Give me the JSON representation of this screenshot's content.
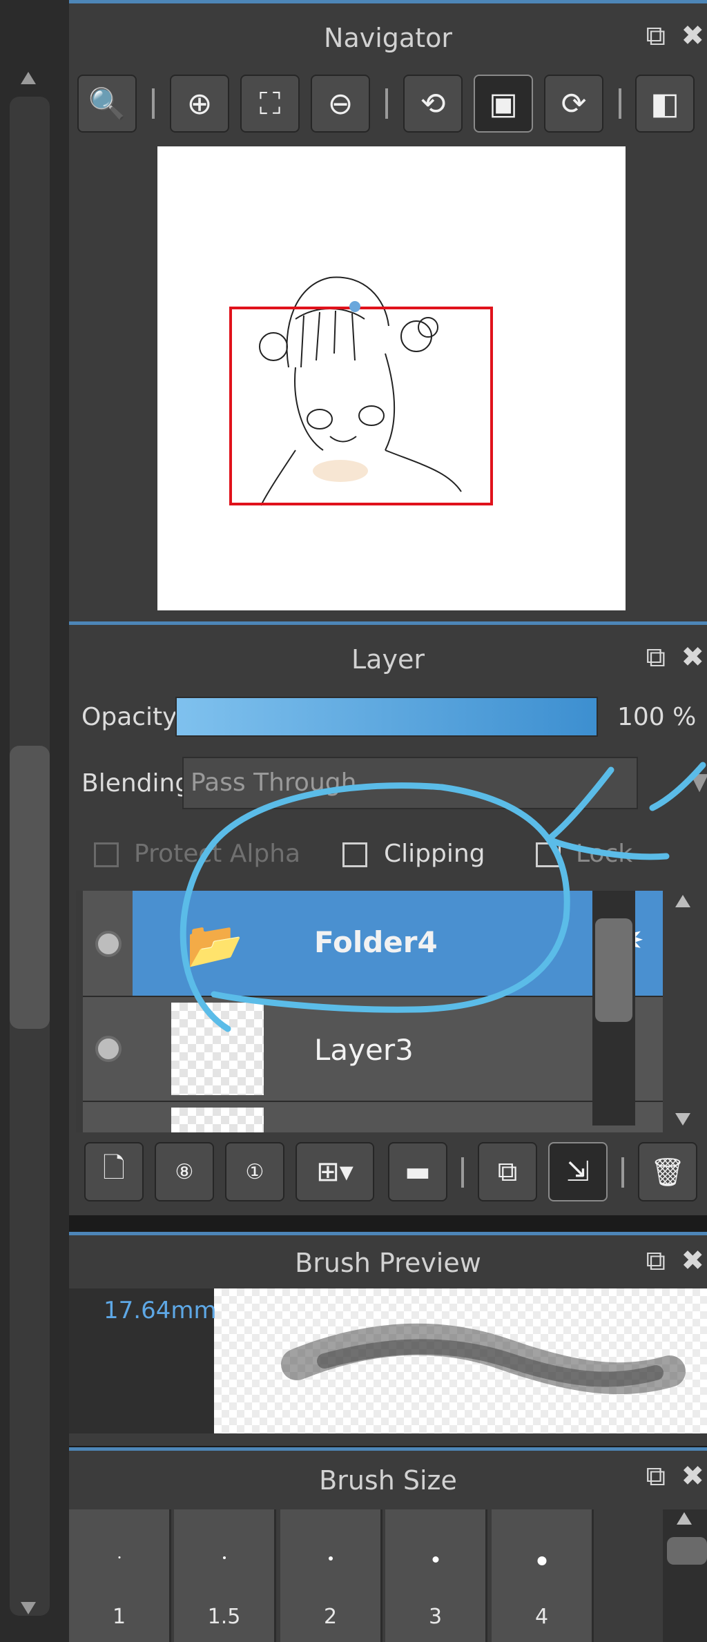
{
  "navigator": {
    "title": "Navigator",
    "toolbar": [
      {
        "icon": "zoom-actual-icon",
        "glyph": "🔍"
      },
      {
        "icon": "zoom-in-icon",
        "glyph": "⊕"
      },
      {
        "icon": "fit-screen-icon",
        "glyph": "⛶"
      },
      {
        "icon": "zoom-out-icon",
        "glyph": "⊖"
      },
      {
        "icon": "rotate-left-icon",
        "glyph": "⟲"
      },
      {
        "icon": "fit-window-icon",
        "glyph": "▣"
      },
      {
        "icon": "rotate-right-icon",
        "glyph": "⟳"
      },
      {
        "icon": "flip-icon",
        "glyph": "◧"
      }
    ]
  },
  "layer_panel": {
    "title": "Layer",
    "opacity_label": "Opacity",
    "opacity_value": "100 %",
    "opacity_percent": 100,
    "blending_label": "Blending",
    "blending_value": "Pass Through",
    "protect_alpha_label": "Protect Alpha",
    "clipping_label": "Clipping",
    "lock_label": "Lock",
    "layers": [
      {
        "name": "Folder4",
        "type": "folder",
        "selected": true
      },
      {
        "name": "Layer3",
        "type": "layer",
        "selected": false
      }
    ]
  },
  "brush_preview": {
    "title": "Brush Preview",
    "size_readout": "17.64mm"
  },
  "brush_size": {
    "title": "Brush Size",
    "sizes": [
      "1",
      "1.5",
      "2",
      "3",
      "4"
    ]
  },
  "colors": {
    "accent": "#4d86b8",
    "selected_row": "#4a90d0",
    "annotation": "#5bbce8",
    "view_rect": "#e0121b"
  }
}
